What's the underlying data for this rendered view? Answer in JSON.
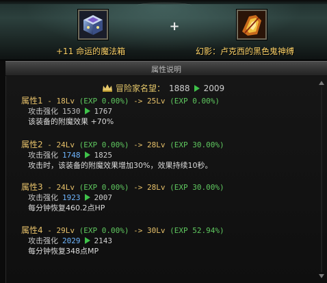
{
  "banner": {
    "left_item_name": "+11 命运的魔法箱",
    "plus_symbol": "+",
    "right_item_name": "幻影：卢克西的黑色鬼神缚"
  },
  "panel": {
    "title": "属性说明"
  },
  "fame": {
    "label": "冒险家名望：",
    "old": "1888",
    "new": "2009"
  },
  "attributes": [
    {
      "label": "属性1",
      "sep": " - ",
      "from_lv": "18Lv",
      "from_exp": "(EXP 0.00%)",
      "arrow": " -> ",
      "to_lv": "25Lv",
      "to_exp": "(EXP 0.00%)",
      "stat_label": "攻击强化",
      "stat_old": "1530",
      "stat_old_highlight": false,
      "stat_new": "1767",
      "desc": "该装备的附魔效果 +70%"
    },
    {
      "label": "属性2",
      "sep": " - ",
      "from_lv": "24Lv",
      "from_exp": "(EXP 0.00%)",
      "arrow": " -> ",
      "to_lv": "28Lv",
      "to_exp": "(EXP 30.00%)",
      "stat_label": "攻击强化",
      "stat_old": "1748",
      "stat_old_highlight": true,
      "stat_new": "1825",
      "desc": "攻击时，该装备的附魔效果增加30%，效果持续10秒。"
    },
    {
      "label": "属性3",
      "sep": " - ",
      "from_lv": "24Lv",
      "from_exp": "(EXP 0.00%)",
      "arrow": " -> ",
      "to_lv": "28Lv",
      "to_exp": "(EXP 30.00%)",
      "stat_label": "攻击强化",
      "stat_old": "1923",
      "stat_old_highlight": true,
      "stat_new": "2007",
      "desc": "每分钟恢复460.2点HP"
    },
    {
      "label": "属性4",
      "sep": " - ",
      "from_lv": "29Lv",
      "from_exp": "(EXP 0.00%)",
      "arrow": " -> ",
      "to_lv": "30Lv",
      "to_exp": "(EXP 52.94%)",
      "stat_label": "攻击强化",
      "stat_old": "2029",
      "stat_old_highlight": true,
      "stat_new": "2143",
      "desc": "每分钟恢复348点MP"
    }
  ],
  "colors": {
    "gold_text": "#e8c26a",
    "green_exp": "#5fc85f",
    "arrow_green": "#3fc24a",
    "highlight_blue": "#6fb6ff",
    "item_name_yellow": "#ffd56a"
  },
  "icons": {
    "left_slot": "magic-box-icon",
    "right_slot": "ghost-bracer-icon",
    "fame": "fame-crown-icon"
  }
}
